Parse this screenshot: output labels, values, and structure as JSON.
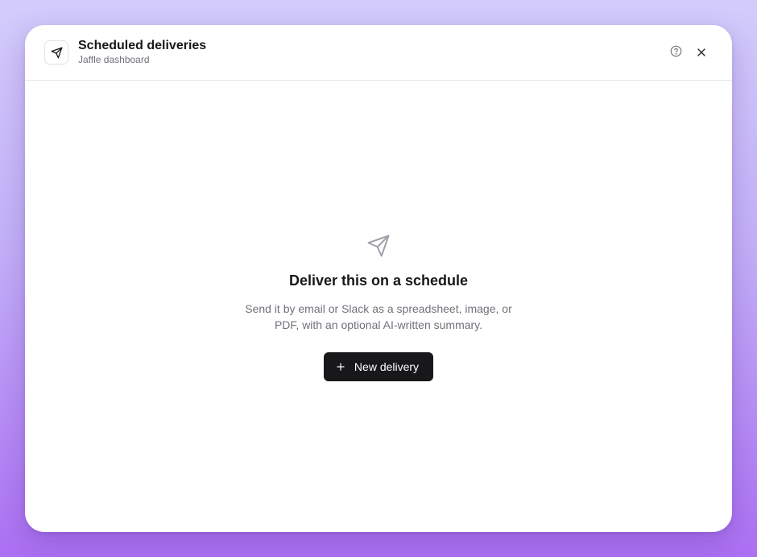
{
  "header": {
    "title": "Scheduled deliveries",
    "subtitle": "Jaffle dashboard",
    "icon": "send-icon",
    "help_icon": "help-circle-icon",
    "close_icon": "close-icon"
  },
  "empty_state": {
    "icon": "send-icon",
    "title": "Deliver this on a schedule",
    "description": "Send it by email or Slack as a spreadsheet, image, or PDF, with an optional AI-written summary.",
    "button_label": "New delivery",
    "button_icon": "plus-icon"
  },
  "colors": {
    "primary_button": "#18181b",
    "muted_text": "#71717a",
    "icon_muted": "#a1a1aa"
  }
}
